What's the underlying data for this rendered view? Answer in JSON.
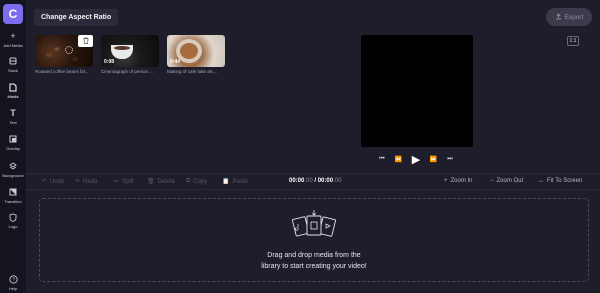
{
  "app": {
    "logo_letter": "C"
  },
  "sidebar": {
    "items": [
      {
        "label": "Add Media",
        "icon": "plus-icon"
      },
      {
        "label": "Stock",
        "icon": "stock-icon"
      },
      {
        "label": "Media",
        "icon": "media-icon"
      },
      {
        "label": "Text",
        "icon": "text-icon"
      },
      {
        "label": "Overlay",
        "icon": "overlay-icon"
      },
      {
        "label": "Background",
        "icon": "background-icon"
      },
      {
        "label": "Transition",
        "icon": "transition-icon"
      },
      {
        "label": "Logo",
        "icon": "logo-icon"
      },
      {
        "label": "Help",
        "icon": "help-icon"
      }
    ]
  },
  "header": {
    "title": "Change Aspect Ratio",
    "export_label": "Export"
  },
  "media": {
    "items": [
      {
        "caption": "Roasted coffee beans fal...",
        "duration": ""
      },
      {
        "caption": "Cinemagraph of person ...",
        "duration": "0:08"
      },
      {
        "caption": "Making of cafe latte art,...",
        "duration": "0:44"
      }
    ]
  },
  "preview": {
    "ratio_label": "1:1"
  },
  "toolbar": {
    "undo": "Undo",
    "redo": "Redo",
    "split": "Split",
    "delete": "Delete",
    "copy": "Copy",
    "paste": "Paste",
    "time_current": "00:00",
    "time_current_ms": ".00",
    "time_separator": " / ",
    "time_total": "00:00",
    "time_total_ms": ".00",
    "zoom_in": "Zoom In",
    "zoom_out": "Zoom Out",
    "fit": "Fit To Screen"
  },
  "timeline": {
    "drop_line1": "Drag and drop media from the",
    "drop_line2": "library to start creating your video!"
  },
  "colors": {
    "background": "#1d1d2b",
    "sidebar": "#14141f",
    "accent": "#7c6cf0"
  }
}
